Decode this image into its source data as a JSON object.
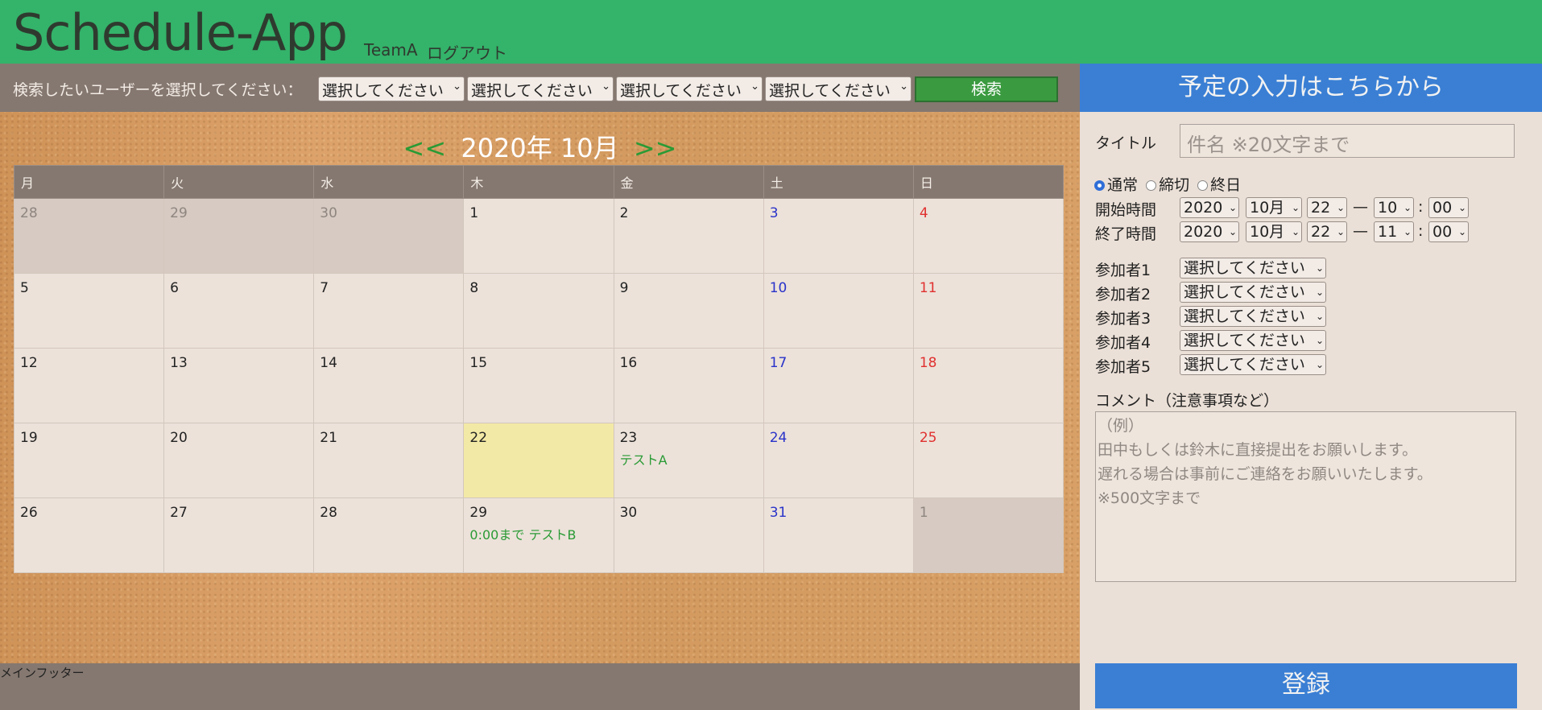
{
  "header": {
    "app_title": "Schedule-App",
    "team": "TeamA",
    "logout": "ログアウト"
  },
  "search": {
    "label": "検索したいユーザーを選択してください：",
    "user_selects": [
      "選択してください",
      "選択してください",
      "選択してください",
      "選択してください"
    ],
    "button": "検索"
  },
  "calendar": {
    "prev": "<<",
    "next": ">>",
    "month_label": "2020年 10月",
    "weekdays": [
      "月",
      "火",
      "水",
      "木",
      "金",
      "土",
      "日"
    ],
    "weeks": [
      [
        {
          "day": "28",
          "other": true
        },
        {
          "day": "29",
          "other": true
        },
        {
          "day": "30",
          "other": true
        },
        {
          "day": "1"
        },
        {
          "day": "2"
        },
        {
          "day": "3"
        },
        {
          "day": "4"
        }
      ],
      [
        {
          "day": "5"
        },
        {
          "day": "6"
        },
        {
          "day": "7"
        },
        {
          "day": "8"
        },
        {
          "day": "9"
        },
        {
          "day": "10"
        },
        {
          "day": "11"
        }
      ],
      [
        {
          "day": "12"
        },
        {
          "day": "13"
        },
        {
          "day": "14"
        },
        {
          "day": "15"
        },
        {
          "day": "16"
        },
        {
          "day": "17"
        },
        {
          "day": "18"
        }
      ],
      [
        {
          "day": "19"
        },
        {
          "day": "20"
        },
        {
          "day": "21"
        },
        {
          "day": "22",
          "today": true
        },
        {
          "day": "23",
          "events": [
            "テストA"
          ]
        },
        {
          "day": "24"
        },
        {
          "day": "25"
        }
      ],
      [
        {
          "day": "26"
        },
        {
          "day": "27"
        },
        {
          "day": "28"
        },
        {
          "day": "29",
          "events": [
            "0:00まで テストB"
          ]
        },
        {
          "day": "30"
        },
        {
          "day": "31"
        },
        {
          "day": "1",
          "other": true
        }
      ]
    ]
  },
  "footer": {
    "text": "メインフッター"
  },
  "form": {
    "header": "予定の入力はこちらから",
    "title_label": "タイトル",
    "title_placeholder": "件名 ※20文字まで",
    "types": [
      {
        "label": "通常",
        "selected": true
      },
      {
        "label": "締切",
        "selected": false
      },
      {
        "label": "終日",
        "selected": false
      }
    ],
    "start_label": "開始時間",
    "end_label": "終了時間",
    "start": {
      "year": "2020",
      "month": "10月",
      "day": "22",
      "hour": "10",
      "minute": "00"
    },
    "end": {
      "year": "2020",
      "month": "10月",
      "day": "22",
      "hour": "11",
      "minute": "00"
    },
    "dash": "—",
    "colon": ":",
    "participants": [
      {
        "label": "参加者1",
        "value": "選択してください"
      },
      {
        "label": "参加者2",
        "value": "選択してください"
      },
      {
        "label": "参加者3",
        "value": "選択してください"
      },
      {
        "label": "参加者4",
        "value": "選択してください"
      },
      {
        "label": "参加者5",
        "value": "選択してください"
      }
    ],
    "comment_label": "コメント（注意事項など）",
    "comment_placeholder": "（例）\n田中もしくは鈴木に直接提出をお願いします。\n遅れる場合は事前にご連絡をお願いいたします。\n※500文字まで",
    "register_button": "登録"
  },
  "colors": {
    "header_green": "#34b36a",
    "panel_blue": "#3a7fd4",
    "saturday": "#2a33c9",
    "sunday": "#e0302f",
    "event_green": "#2a9a35",
    "today": "#f3e9a6"
  }
}
